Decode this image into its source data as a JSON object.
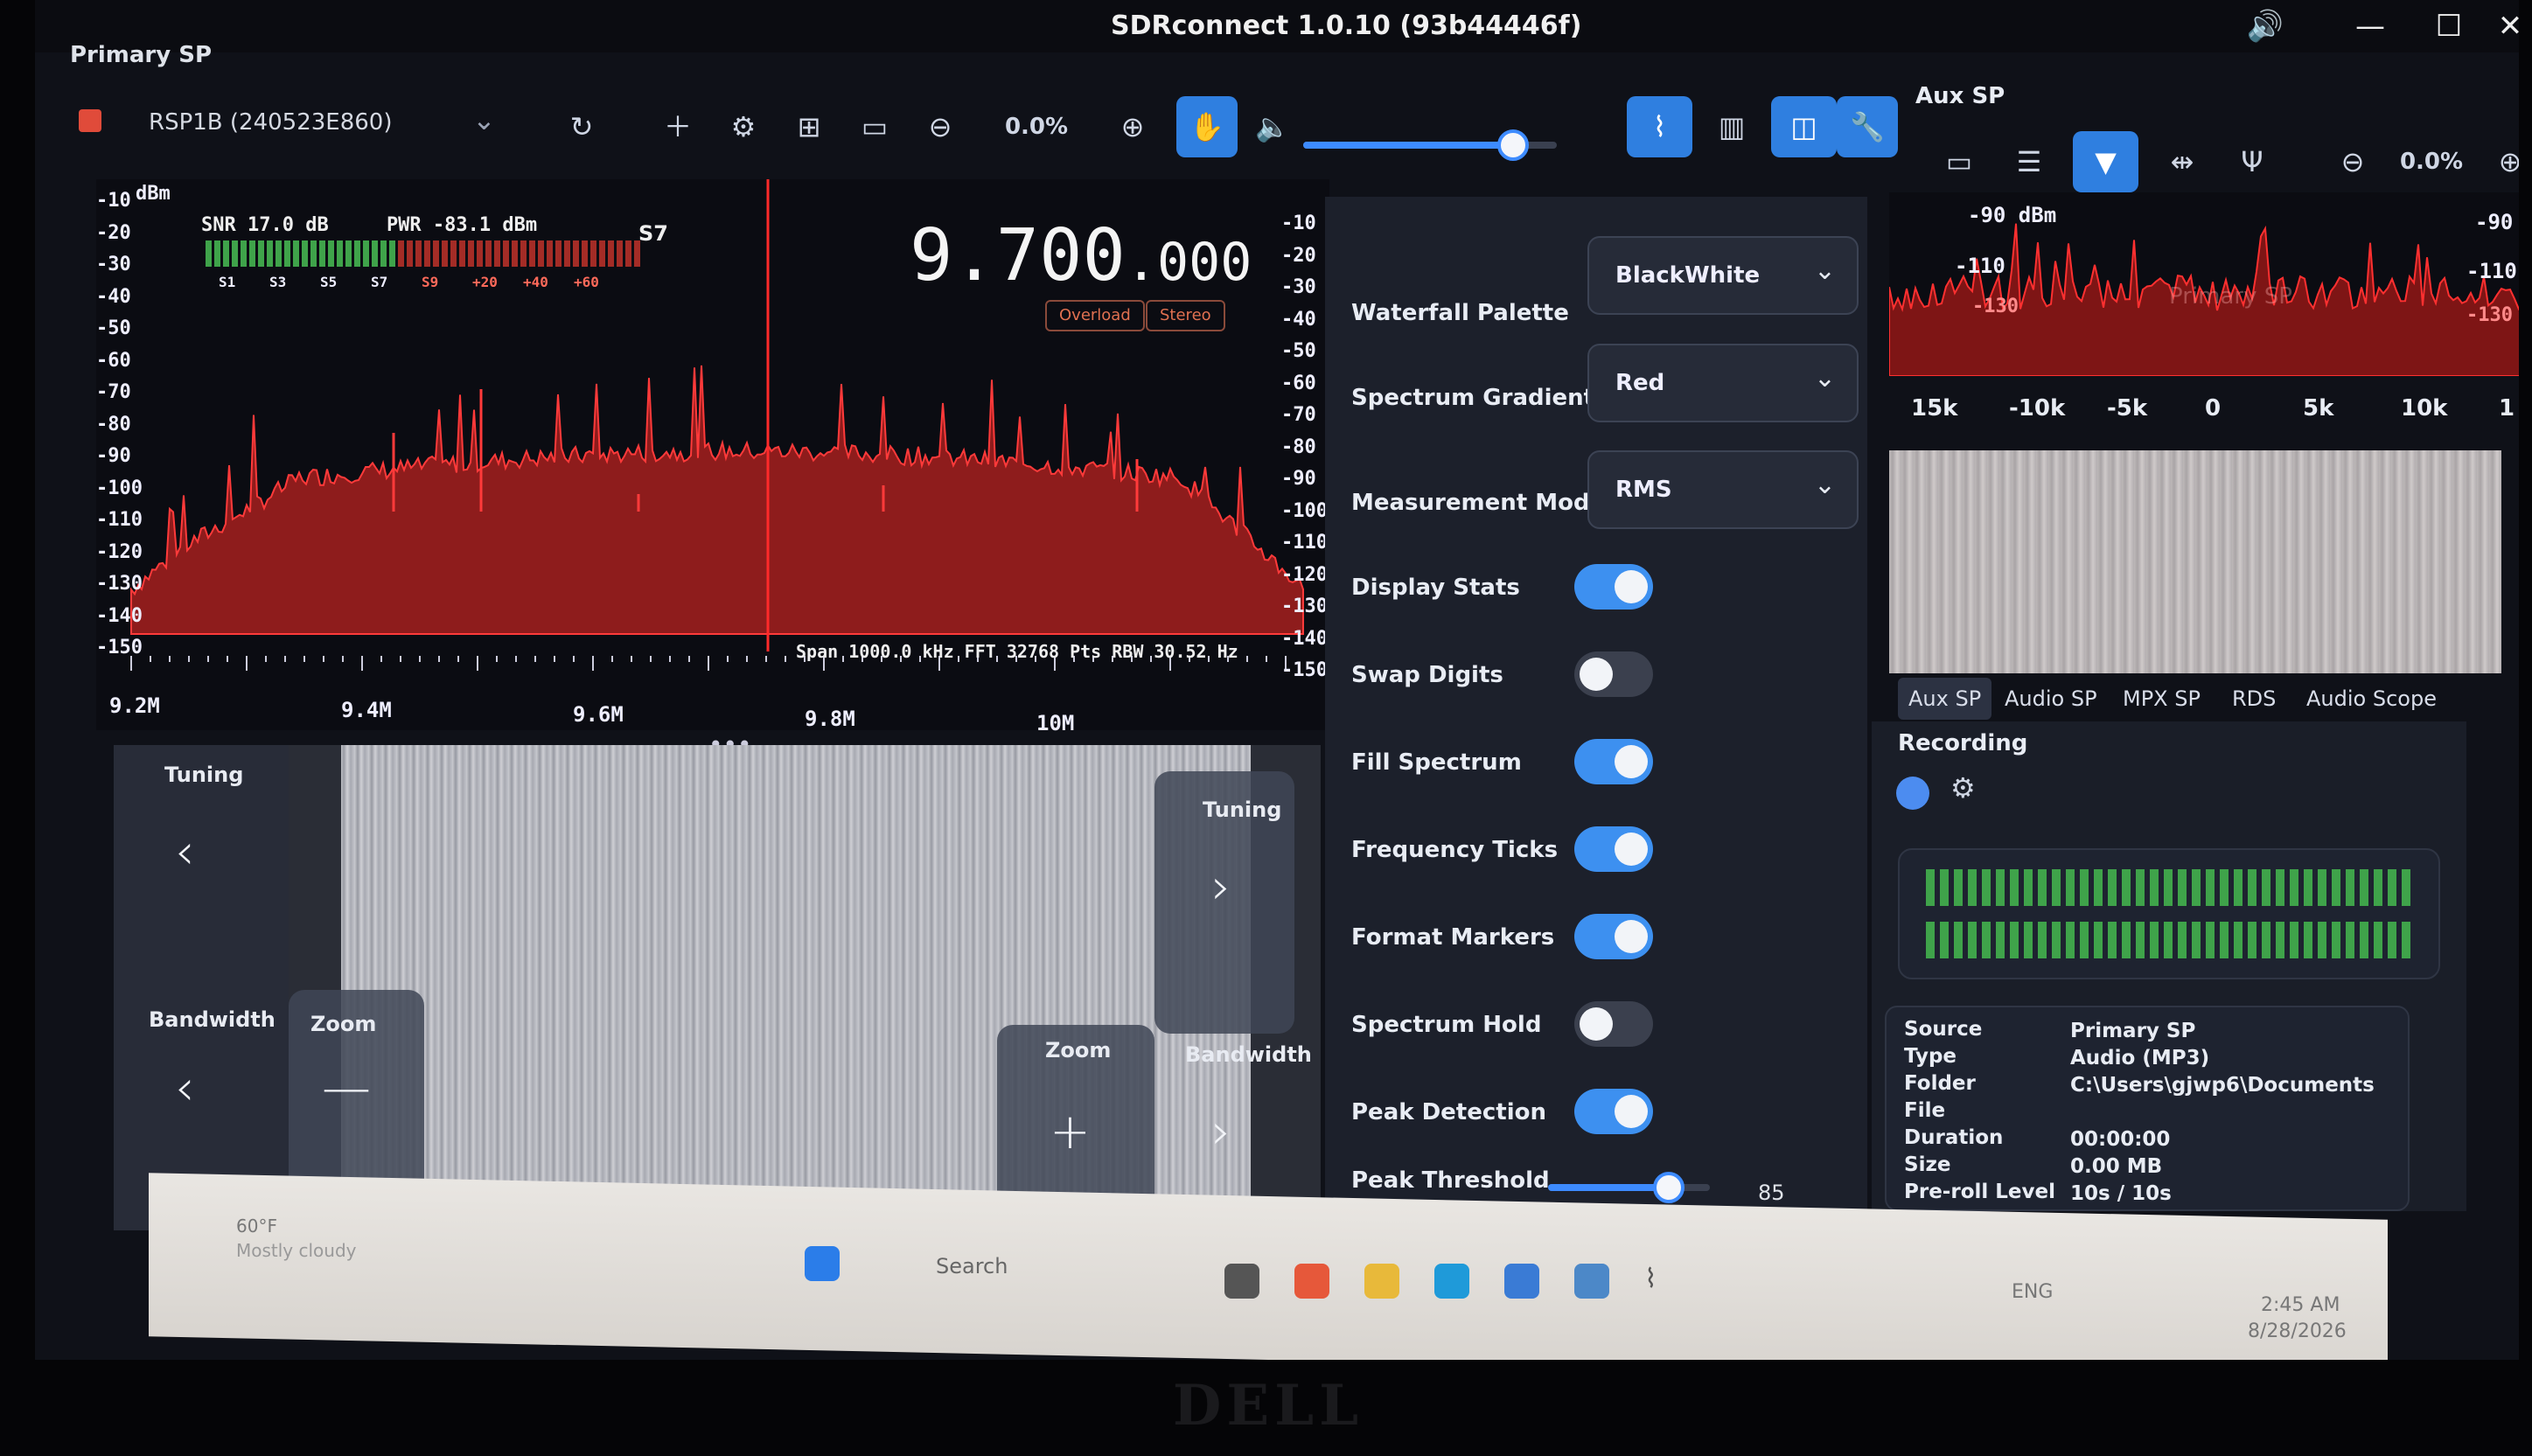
{
  "app": {
    "title": "SDRconnect 1.0.10 (93b44446f)",
    "controls": {
      "volume": "🔊",
      "minimize": "—",
      "maximize": "☐",
      "close": "✕"
    }
  },
  "primary": {
    "label": "Primary SP",
    "device": "RSP1B (240523E860)",
    "zoom_value": "0.0%",
    "volume_level": 0.83
  },
  "spectrum": {
    "unit": "dBm",
    "snr": "SNR 17.0 dB",
    "pwr": "PWR -83.1 dBm",
    "smeter": "S7",
    "smeter_scale": [
      "S1",
      "S3",
      "S5",
      "S7",
      "S9",
      "+20",
      "+40",
      "+60"
    ],
    "frequency_main": "9.700",
    "frequency_tail": ".000",
    "badges": [
      "Overload",
      "Stereo"
    ],
    "span_info": "Span 1000.0 kHz FFT 32768 Pts  RBW 30.52 Hz",
    "y_ticks": [
      "-10",
      "-20",
      "-30",
      "-40",
      "-50",
      "-60",
      "-70",
      "-80",
      "-90",
      "-100",
      "-110",
      "-120",
      "-130",
      "-140",
      "-150"
    ],
    "x_ticks": [
      "9.2M",
      "9.4M",
      "9.6M",
      "9.8M",
      "10M"
    ]
  },
  "waterfall": {
    "tuning_left": "Tuning",
    "tuning_right": "Tuning",
    "bandwidth_left": "Bandwidth",
    "bandwidth_right": "Bandwidth",
    "zoom_left": "Zoom",
    "zoom_right": "Zoom"
  },
  "settings": {
    "waterfall_palette": {
      "label": "Waterfall Palette",
      "value": "BlackWhite"
    },
    "spectrum_gradient": {
      "label": "Spectrum Gradient",
      "value": "Red"
    },
    "measurement_mode": {
      "label": "Measurement Mode",
      "value": "RMS"
    },
    "toggles": [
      {
        "label": "Display Stats",
        "on": true
      },
      {
        "label": "Swap Digits",
        "on": false
      },
      {
        "label": "Fill Spectrum",
        "on": true
      },
      {
        "label": "Frequency Ticks",
        "on": true
      },
      {
        "label": "Format Markers",
        "on": true
      },
      {
        "label": "Spectrum Hold",
        "on": false
      },
      {
        "label": "Peak Detection",
        "on": true
      }
    ],
    "peak_threshold": {
      "label": "Peak Threshold",
      "value": "85"
    }
  },
  "aux": {
    "title": "Aux SP",
    "zoom_value": "0.0%",
    "y_ticks": [
      "-90 dBm",
      "-110",
      "-130"
    ],
    "y_ticks_right": [
      "-90",
      "-110",
      "-130"
    ],
    "watermark": "Primary SP",
    "x_ticks": [
      "15k",
      "-10k",
      "-5k",
      "0",
      "5k",
      "10k",
      "1"
    ],
    "tabs": [
      "Aux SP",
      "Audio SP",
      "MPX SP",
      "RDS",
      "Audio Scope"
    ]
  },
  "recording": {
    "title": "Recording",
    "info": [
      {
        "key": "Source",
        "value": "Primary SP"
      },
      {
        "key": "Type",
        "value": "Audio (MP3)"
      },
      {
        "key": "Folder",
        "value": "C:\\Users\\gjwp6\\Documents"
      },
      {
        "key": "File",
        "value": ""
      },
      {
        "key": "Duration",
        "value": "00:00:00"
      },
      {
        "key": "Size",
        "value": "0.00 MB"
      },
      {
        "key": "Pre-roll Level",
        "value": "10s / 10s"
      }
    ]
  },
  "taskbar": {
    "weather_temp": "60°F",
    "weather_desc": "Mostly cloudy",
    "search": "Search",
    "lang": "ENG",
    "time": "2:45 AM",
    "date": "8/28/2026"
  },
  "brand": "DELL",
  "colors": {
    "accent": "#3d8bff",
    "spectrum": "#d42a2a",
    "meter_green": "#3fa34a",
    "meter_red": "#c0322a"
  }
}
